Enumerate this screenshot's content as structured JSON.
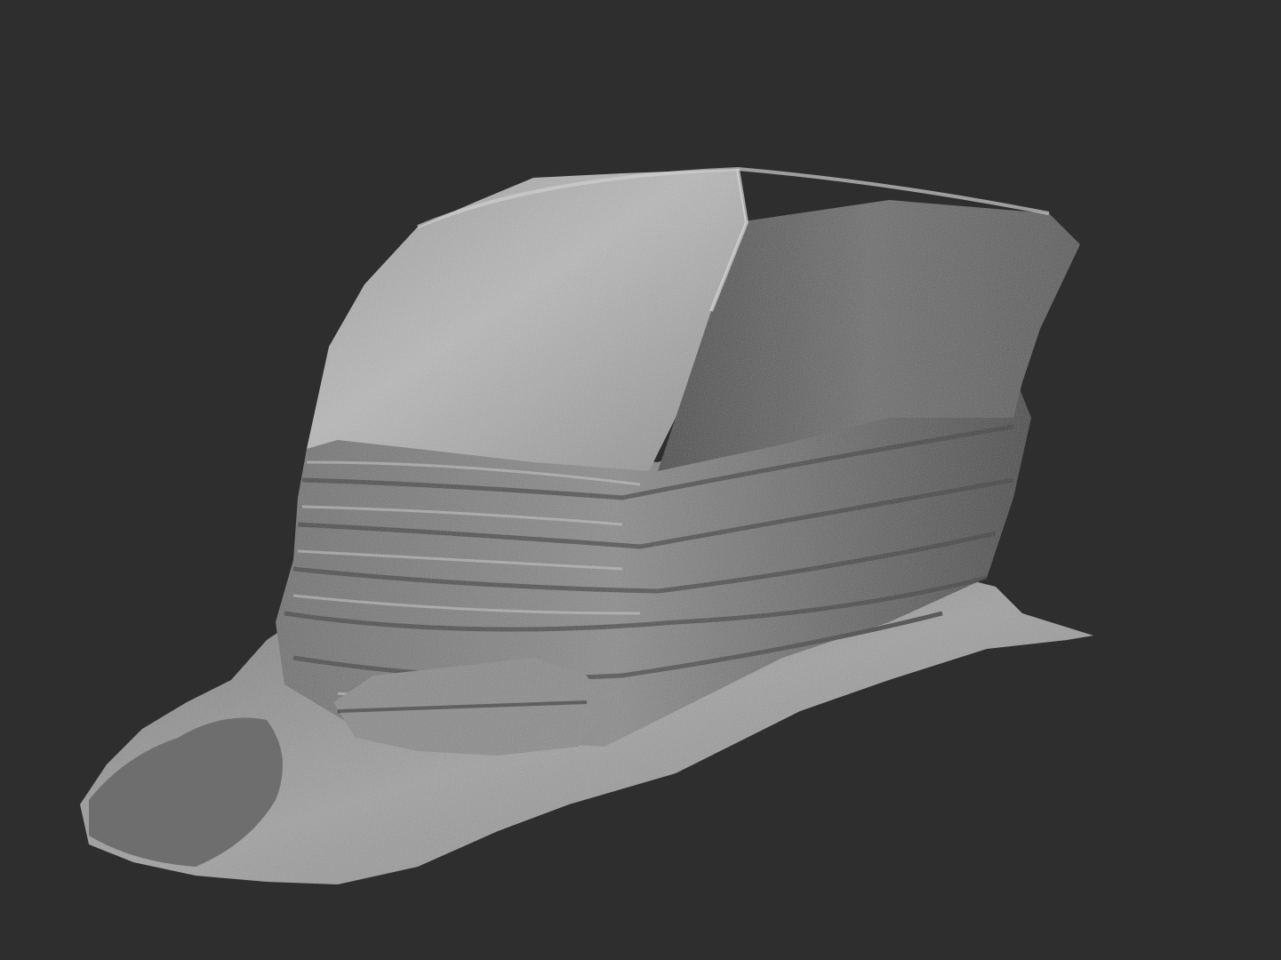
{
  "scene": {
    "subject": "rock-scan-model",
    "colors": {
      "background": "#2e2e2e",
      "rock_light": "#bdbdbd",
      "rock_mid": "#8c8c8c",
      "rock_dark": "#3f3f3f",
      "ground": "#9a9a9a"
    }
  }
}
